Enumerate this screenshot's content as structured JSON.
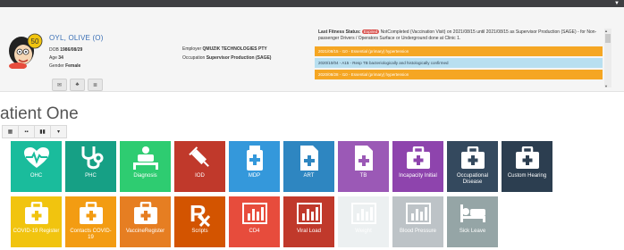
{
  "patient": {
    "name": "OYL, OLIVE (O)",
    "dob_label": "DOB",
    "dob": "1986/08/29",
    "age_label": "Age",
    "age": "34",
    "gender_label": "Gender",
    "gender": "Female",
    "employer_label": "Employer",
    "employer": "QMUZIK TECHNOLOGIES PTY",
    "occupation_label": "Occupation",
    "occupation": "Supervisor Production (SAGE)",
    "avatar_badge": "50"
  },
  "fitness": {
    "label": "Last Fitness Status:",
    "badge": "Expired",
    "text": "NotCompleted (Vaccination Visit) on 2021/08/15 until 2021/08/15 as Supervisor Production (SAGE) - for Non-passenger Drivers / Operators Surface or Underground done at Clinic 1."
  },
  "notices": [
    {
      "text": "2021/08/15 - I10 - Essential (primary) hypertension",
      "color": "orange"
    },
    {
      "text": "2020/10/04 - A15 - Resp TB bacteriologically and histologically confirmed",
      "color": "blue"
    },
    {
      "text": "2020/08/28 - I10 - Essential (primary) hypertension",
      "color": "orange"
    }
  ],
  "page": {
    "title": "atient One"
  },
  "tiles_row1": [
    {
      "label": "OHC",
      "color": "#1abc9c",
      "icon": "heart-pulse-icon"
    },
    {
      "label": "PHC",
      "color": "#16a085",
      "icon": "stethoscope-icon"
    },
    {
      "label": "Diagnosis",
      "color": "#2ecc71",
      "icon": "patient-bed-icon"
    },
    {
      "label": "IOD",
      "color": "#c0392b",
      "icon": "syringe-icon"
    },
    {
      "label": "MDP",
      "color": "#3498db",
      "icon": "medicine-bottle-icon"
    },
    {
      "label": "ART",
      "color": "#2e86c1",
      "icon": "medical-document-icon"
    },
    {
      "label": "TB",
      "color": "#9b59b6",
      "icon": "medical-document-icon"
    },
    {
      "label": "Incapacity Initial",
      "color": "#8e44ad",
      "icon": "medical-case-icon"
    },
    {
      "label": "Occupational Disease",
      "color": "#34495e",
      "icon": "medical-case-icon"
    },
    {
      "label": "Custom Hearing",
      "color": "#2c3e50",
      "icon": "medical-case-icon"
    }
  ],
  "tiles_row2": [
    {
      "label": "COVID-19 Register",
      "color": "#f1c40f",
      "icon": "medical-case-icon"
    },
    {
      "label": "Contacts COVID-19",
      "color": "#f39c12",
      "icon": "medical-case-icon"
    },
    {
      "label": "VaccineRegister",
      "color": "#e67e22",
      "icon": "medical-case-icon"
    },
    {
      "label": "Scripts",
      "color": "#d35400",
      "icon": "prescription-icon"
    },
    {
      "label": "CD4",
      "color": "#e74c3c",
      "icon": "bar-chart-icon"
    },
    {
      "label": "Viral Load",
      "color": "#c0392b",
      "icon": "bar-chart-icon"
    },
    {
      "label": "Weight",
      "color": "#ecf0f1",
      "icon": "bar-chart-icon"
    },
    {
      "label": "Blood Pressure",
      "color": "#bdc3c7",
      "icon": "bar-chart-icon"
    },
    {
      "label": "Sick Leave",
      "color": "#95a5a6",
      "icon": "bed-icon"
    }
  ]
}
